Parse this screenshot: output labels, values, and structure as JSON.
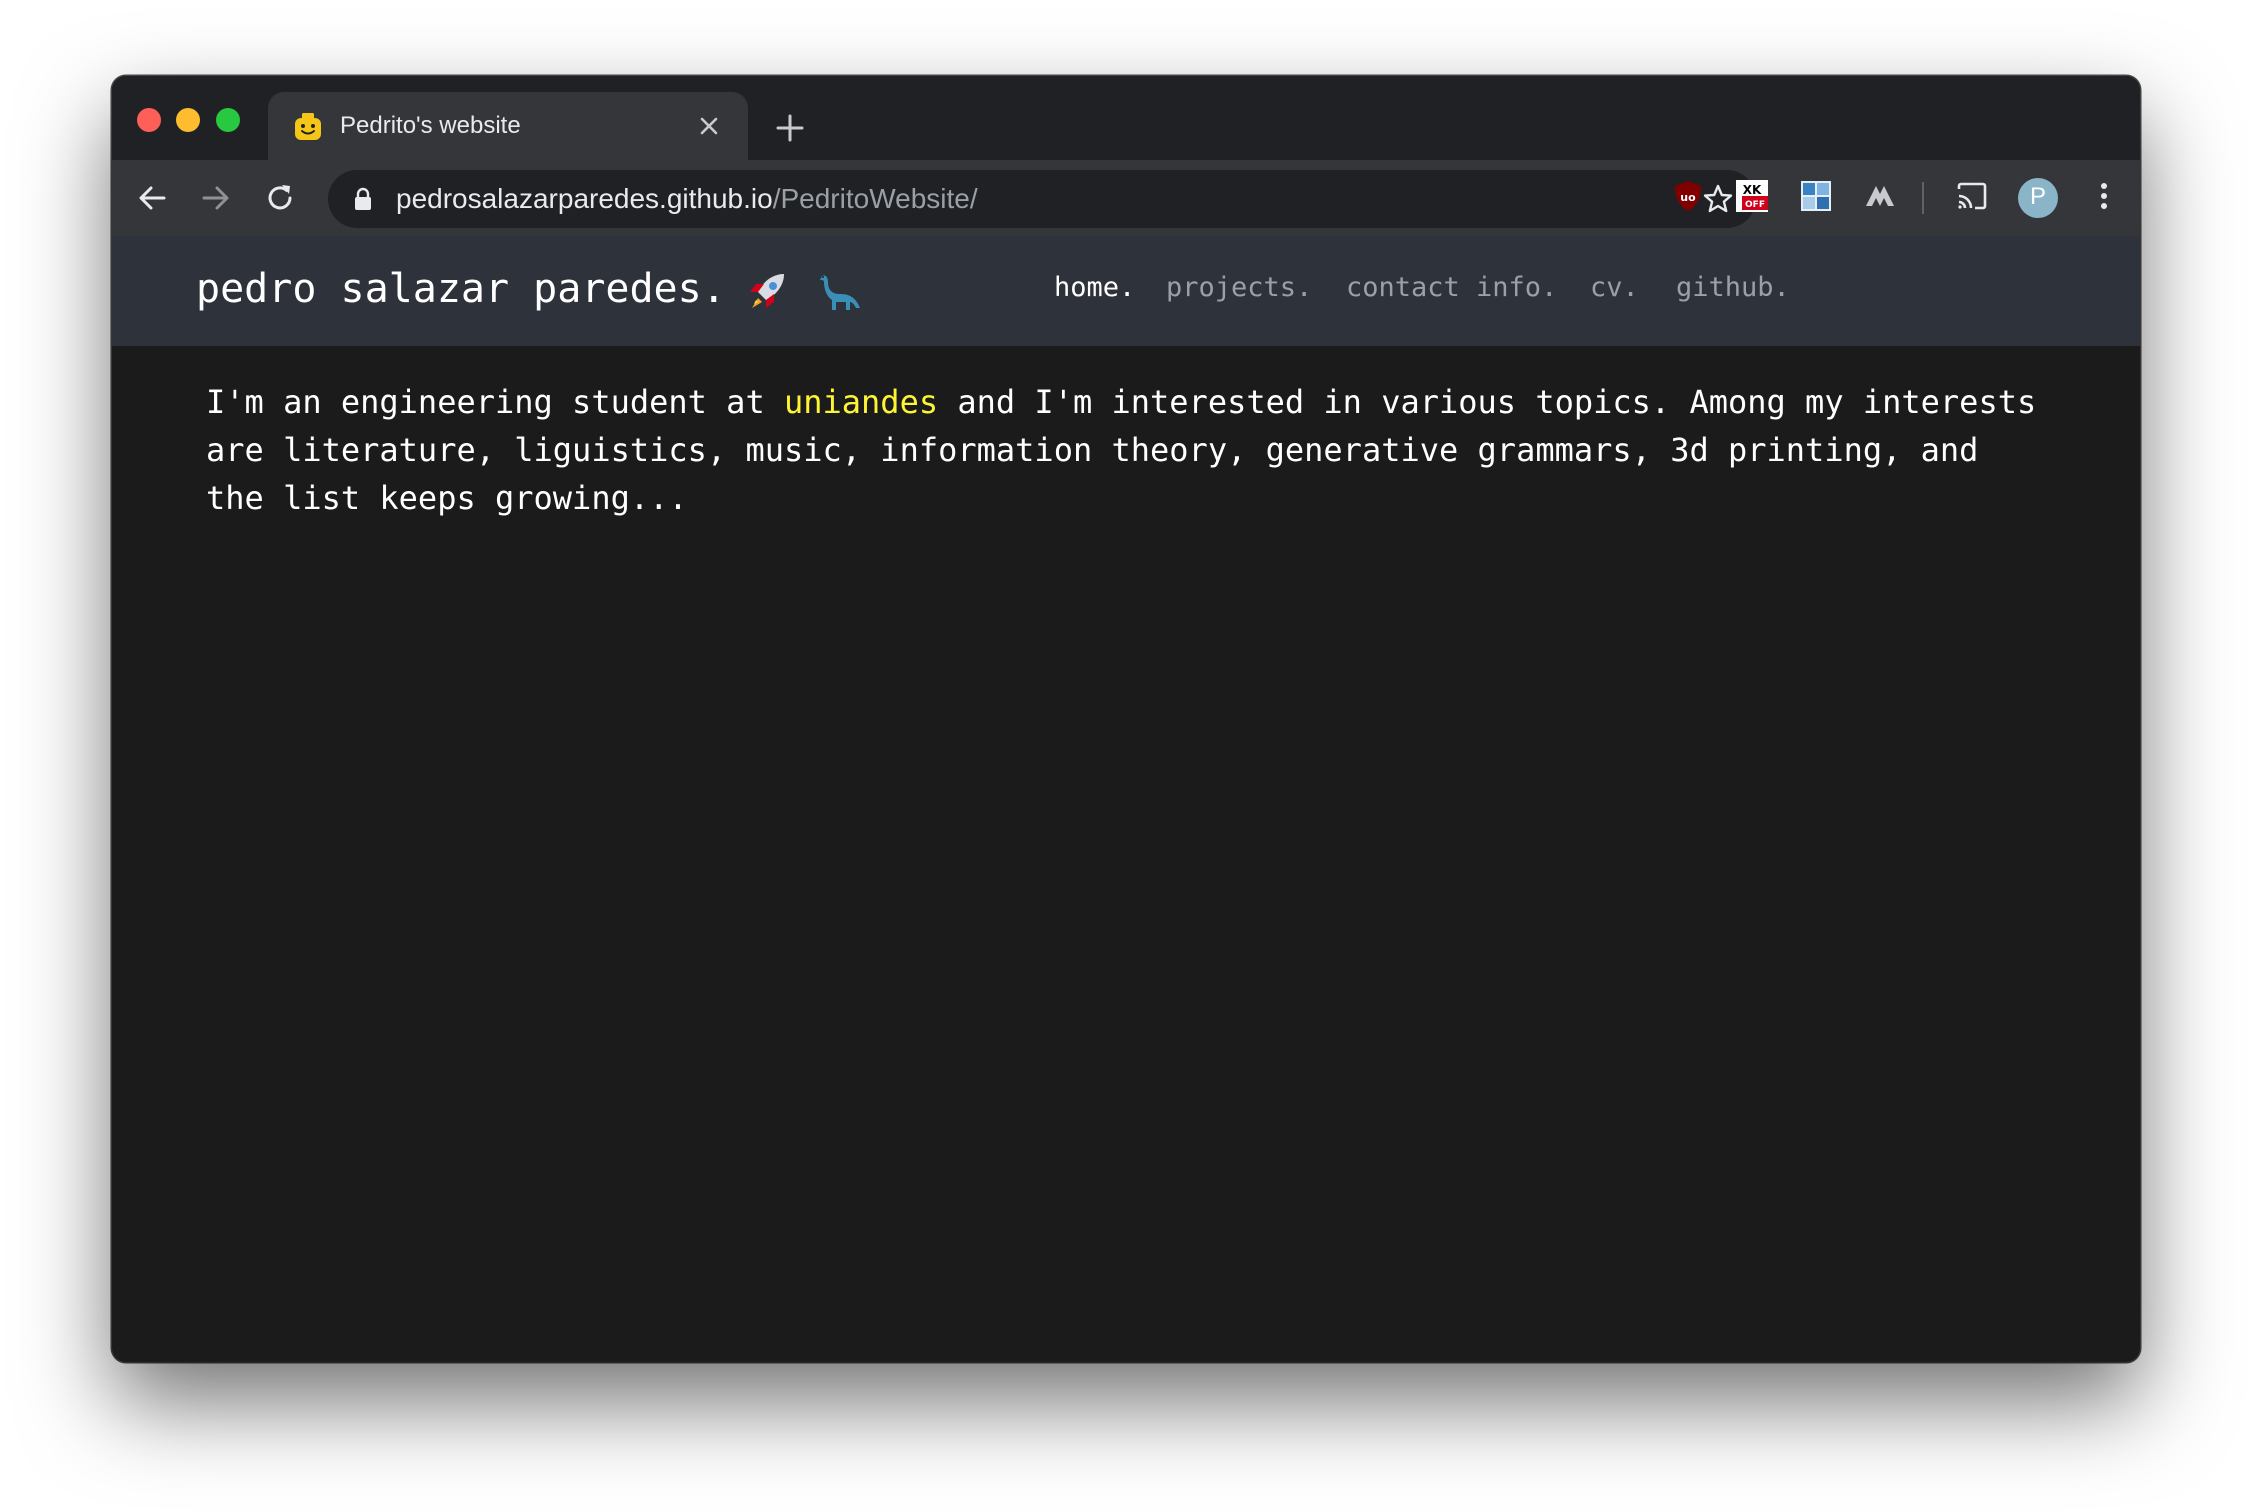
{
  "browser": {
    "tab": {
      "title": "Pedrito's website"
    },
    "address": {
      "host": "pedrosalazarparedes.github.io",
      "path": "/PedritoWebsite/"
    },
    "profile_initial": "P",
    "extensions": [
      "ublock-origin-icon",
      "xkcd-off-icon",
      "wallpaper-extension-icon",
      "nordvpn-icon"
    ]
  },
  "site": {
    "title": "pedro salazar paredes.",
    "title_emojis": [
      "rocket",
      "sauropod"
    ],
    "nav": [
      {
        "label": "home.",
        "active": true
      },
      {
        "label": "projects.",
        "active": false
      },
      {
        "label": "contact info.",
        "active": false
      },
      {
        "label": "cv.",
        "active": false
      },
      {
        "label": "github.",
        "active": false
      }
    ],
    "intro": {
      "line1_before": "I'm an engineering student at ",
      "line1_link": "uniandes",
      "line1_after": " and I'm interested in various topics. Among my interests",
      "line2": "are literature, liguistics, music, information theory, generative grammars, 3d printing, and",
      "line3": "the list keeps growing..."
    }
  },
  "colors": {
    "page_bg": "#1b1b1b",
    "header_bg": "#2e323a",
    "link_highlight": "#fef433",
    "nav_inactive": "#9aa0a6"
  }
}
